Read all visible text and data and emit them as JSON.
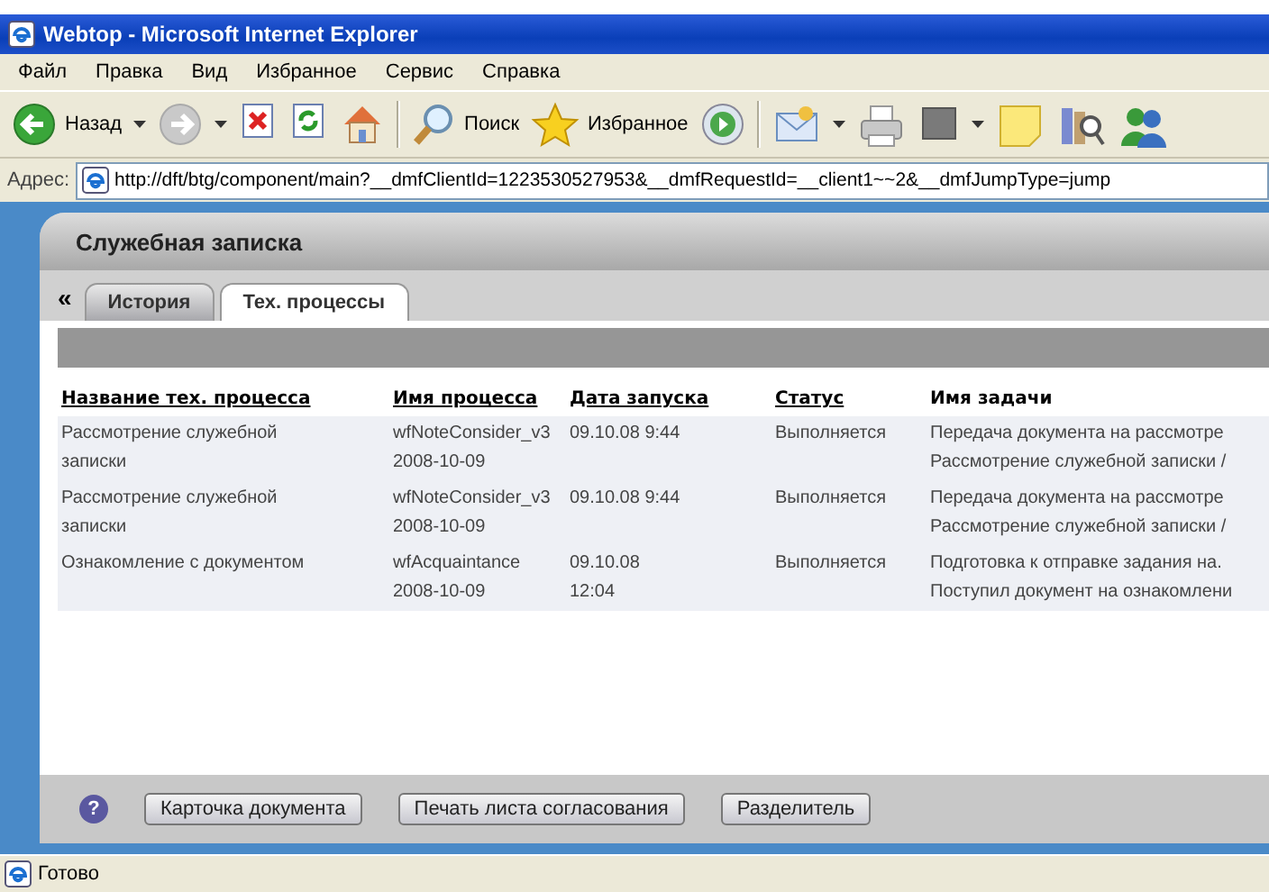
{
  "window": {
    "title": "Webtop - Microsoft Internet Explorer"
  },
  "menu": [
    "Файл",
    "Правка",
    "Вид",
    "Избранное",
    "Сервис",
    "Справка"
  ],
  "toolbar": [
    {
      "kind": "back",
      "label": "Назад",
      "dropdown": true
    },
    {
      "kind": "forward",
      "dropdown": true
    },
    {
      "kind": "stop",
      "dropdown": false
    },
    {
      "kind": "refresh",
      "dropdown": false
    },
    {
      "kind": "home",
      "dropdown": false
    },
    {
      "kind": "separator"
    },
    {
      "kind": "search",
      "label": "Поиск",
      "dropdown": false
    },
    {
      "kind": "favorites",
      "label": "Избранное",
      "dropdown": false
    },
    {
      "kind": "media",
      "dropdown": false
    },
    {
      "kind": "separator"
    },
    {
      "kind": "mail",
      "dropdown": true
    },
    {
      "kind": "print",
      "dropdown": false
    },
    {
      "kind": "edit",
      "dropdown": true
    },
    {
      "kind": "note",
      "dropdown": false
    },
    {
      "kind": "research",
      "dropdown": false
    },
    {
      "kind": "messenger",
      "dropdown": false
    }
  ],
  "address": {
    "label": "Адрес:",
    "value": "http://dft/btg/component/main?__dmfClientId=1223530527953&__dmfRequestId=__client1~~2&__dmfJumpType=jump"
  },
  "panel": {
    "title": "Служебная записка",
    "collapse": "«",
    "tabs": [
      {
        "label": "История",
        "selected": false
      },
      {
        "label": "Тех. процессы",
        "selected": true
      }
    ],
    "table": {
      "columns": [
        {
          "label": "Название тех. процесса",
          "sortable": true
        },
        {
          "label": "Имя процесса",
          "sortable": true
        },
        {
          "label": "Дата запуска",
          "sortable": true
        },
        {
          "label": "Статус",
          "sortable": true
        },
        {
          "label": "Имя задачи",
          "sortable": false
        }
      ],
      "rows": [
        {
          "cells": [
            [
              "Рассмотрение служебной",
              "записки"
            ],
            [
              "wfNoteConsider_v3",
              "2008-10-09"
            ],
            [
              "09.10.08 9:44"
            ],
            [
              "Выполняется"
            ],
            [
              "Передача документа на рассмотре",
              "Рассмотрение служебной записки /"
            ]
          ]
        },
        {
          "cells": [
            [
              "Рассмотрение служебной",
              "записки"
            ],
            [
              "wfNoteConsider_v3",
              "2008-10-09"
            ],
            [
              "09.10.08 9:44"
            ],
            [
              "Выполняется"
            ],
            [
              "Передача документа на рассмотре",
              "Рассмотрение служебной записки /"
            ]
          ]
        },
        {
          "cells": [
            [
              "Ознакомление с документом"
            ],
            [
              "wfAcquaintance",
              "2008-10-09"
            ],
            [
              "09.10.08",
              "12:04"
            ],
            [
              "Выполняется"
            ],
            [
              "Подготовка к отправке задания на.",
              "Поступил документ на ознакомлени"
            ]
          ]
        }
      ]
    },
    "help": "?",
    "buttons": [
      "Карточка документа",
      "Печать листа согласования",
      "Разделитель"
    ]
  },
  "status_bar": {
    "text": "Готово"
  }
}
